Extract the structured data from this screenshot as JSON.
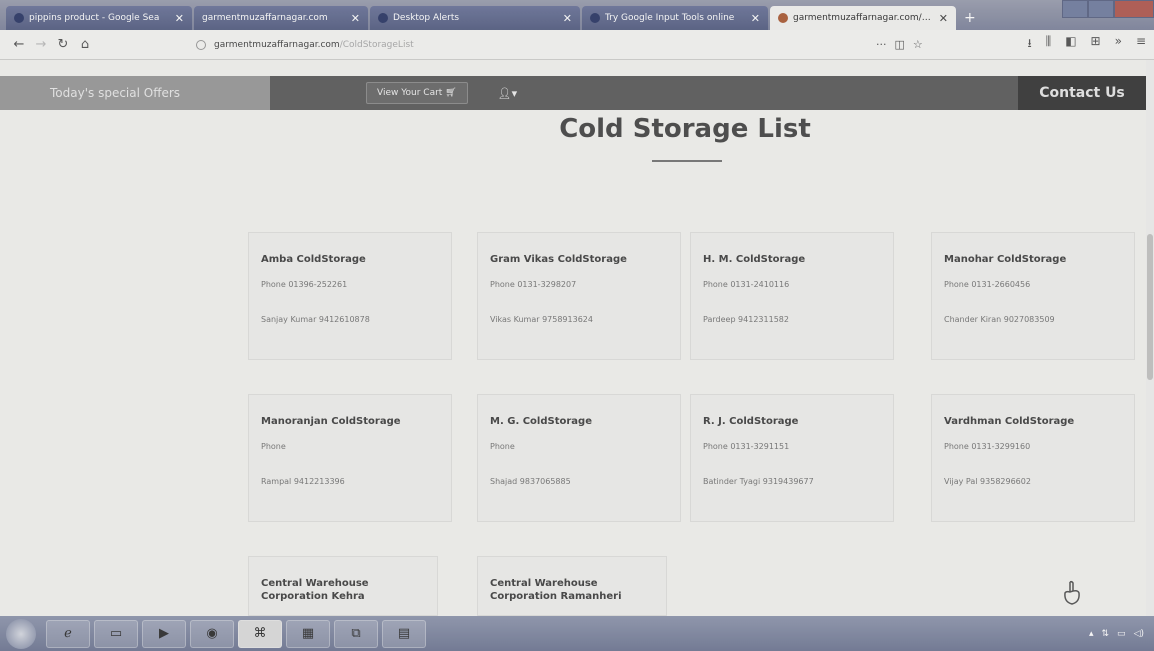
{
  "browser": {
    "tabs": [
      {
        "title": "pippins product - Google Sea",
        "active": false
      },
      {
        "title": "garmentmuzaffarnagar.com",
        "active": false
      },
      {
        "title": "Desktop Alerts",
        "active": false
      },
      {
        "title": "Try Google Input Tools online",
        "active": false
      },
      {
        "title": "garmentmuzaffarnagar.com/Col",
        "active": true
      }
    ],
    "url_host": "garmentmuzaffarnagar.com",
    "url_path": "/ColdStorageList"
  },
  "site": {
    "offers_label": "Today's special Offers",
    "cart_label": "View Your Cart",
    "contact_label": "Contact Us",
    "page_title": "Cold Storage List"
  },
  "cold_storages": [
    {
      "name": "Amba ColdStorage",
      "phone": "Phone 01396-252261",
      "contact": "Sanjay Kumar 9412610878"
    },
    {
      "name": "Gram Vikas ColdStorage",
      "phone": "Phone 0131-3298207",
      "contact": "Vikas Kumar 9758913624"
    },
    {
      "name": "H. M. ColdStorage",
      "phone": "Phone 0131-2410116",
      "contact": "Pardeep 9412311582"
    },
    {
      "name": "Manohar ColdStorage",
      "phone": "Phone 0131-2660456",
      "contact": "Chander Kiran 9027083509"
    },
    {
      "name": "Manoranjan ColdStorage",
      "phone": "Phone",
      "contact": "Rampal 9412213396"
    },
    {
      "name": "M. G. ColdStorage",
      "phone": "Phone",
      "contact": "Shajad 9837065885"
    },
    {
      "name": "R. J. ColdStorage",
      "phone": "Phone 0131-3291151",
      "contact": "Batinder Tyagi 9319439677"
    },
    {
      "name": "Vardhman ColdStorage",
      "phone": "Phone 0131-3299160",
      "contact": "Vijay Pal 9358296602"
    },
    {
      "name": "Central Warehouse Corporation Kehra",
      "phone": "",
      "contact": ""
    },
    {
      "name": "Central Warehouse Corporation Ramanheri",
      "phone": "",
      "contact": ""
    }
  ],
  "icons": {
    "scroll_top": "hand-pointer-up-icon",
    "user": "user-icon",
    "cart": "cart-icon"
  }
}
